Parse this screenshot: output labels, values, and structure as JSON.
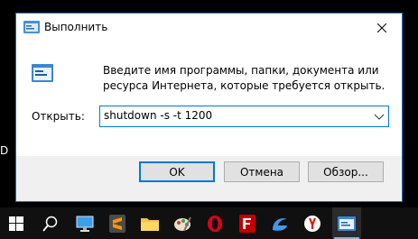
{
  "background": {
    "edge_text": "D"
  },
  "dialog": {
    "title": "Выполнить",
    "description": "Введите имя программы, папки, документа или ресурса Интернета, которые требуется открыть.",
    "open_label": "Открыть:",
    "open_value": "shutdown -s -t 1200",
    "buttons": {
      "ok": "OK",
      "cancel": "Отмена",
      "browse": "Обзор..."
    }
  },
  "taskbar": {
    "items": [
      {
        "name": "start-icon"
      },
      {
        "name": "search-icon"
      },
      {
        "name": "desktop-app-icon"
      },
      {
        "name": "sublime-text-icon"
      },
      {
        "name": "file-explorer-icon"
      },
      {
        "name": "paint-icon"
      },
      {
        "name": "opera-icon"
      },
      {
        "name": "filezilla-icon"
      },
      {
        "name": "edge-icon"
      },
      {
        "name": "yandex-browser-icon"
      },
      {
        "name": "run-dialog-icon",
        "active": true
      }
    ]
  },
  "colors": {
    "accent": "#0078d7",
    "dialog_border": "#1f6fc4",
    "taskbar": "#101010"
  }
}
